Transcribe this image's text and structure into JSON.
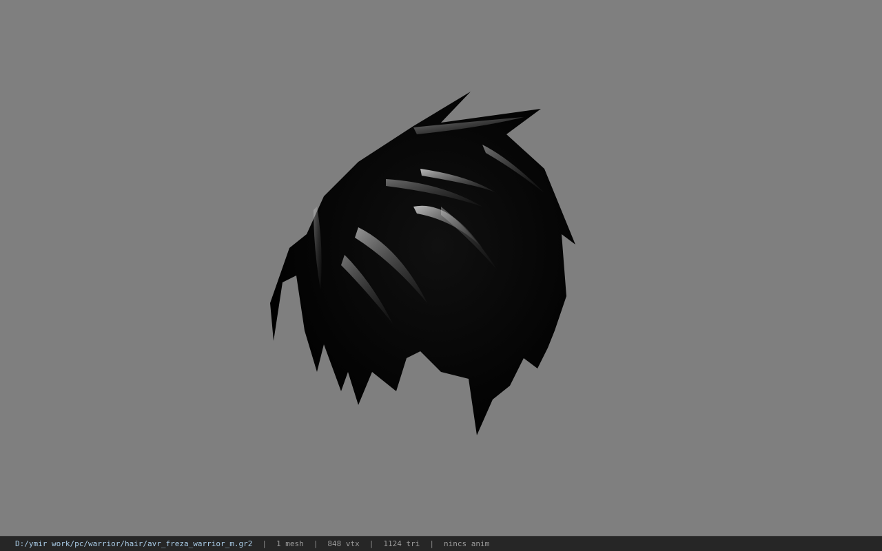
{
  "viewport": {
    "background_color": "#7f7f7f",
    "model_color": "#000000"
  },
  "statusbar": {
    "file_path": "D:/ymir work/pc/warrior/hair/avr_freza_warrior_m.gr2",
    "separator": "|",
    "mesh_count": "1 mesh",
    "vertex_count": "848 vtx",
    "triangle_count": "1124 tri",
    "anim_status": "nincs anim"
  }
}
